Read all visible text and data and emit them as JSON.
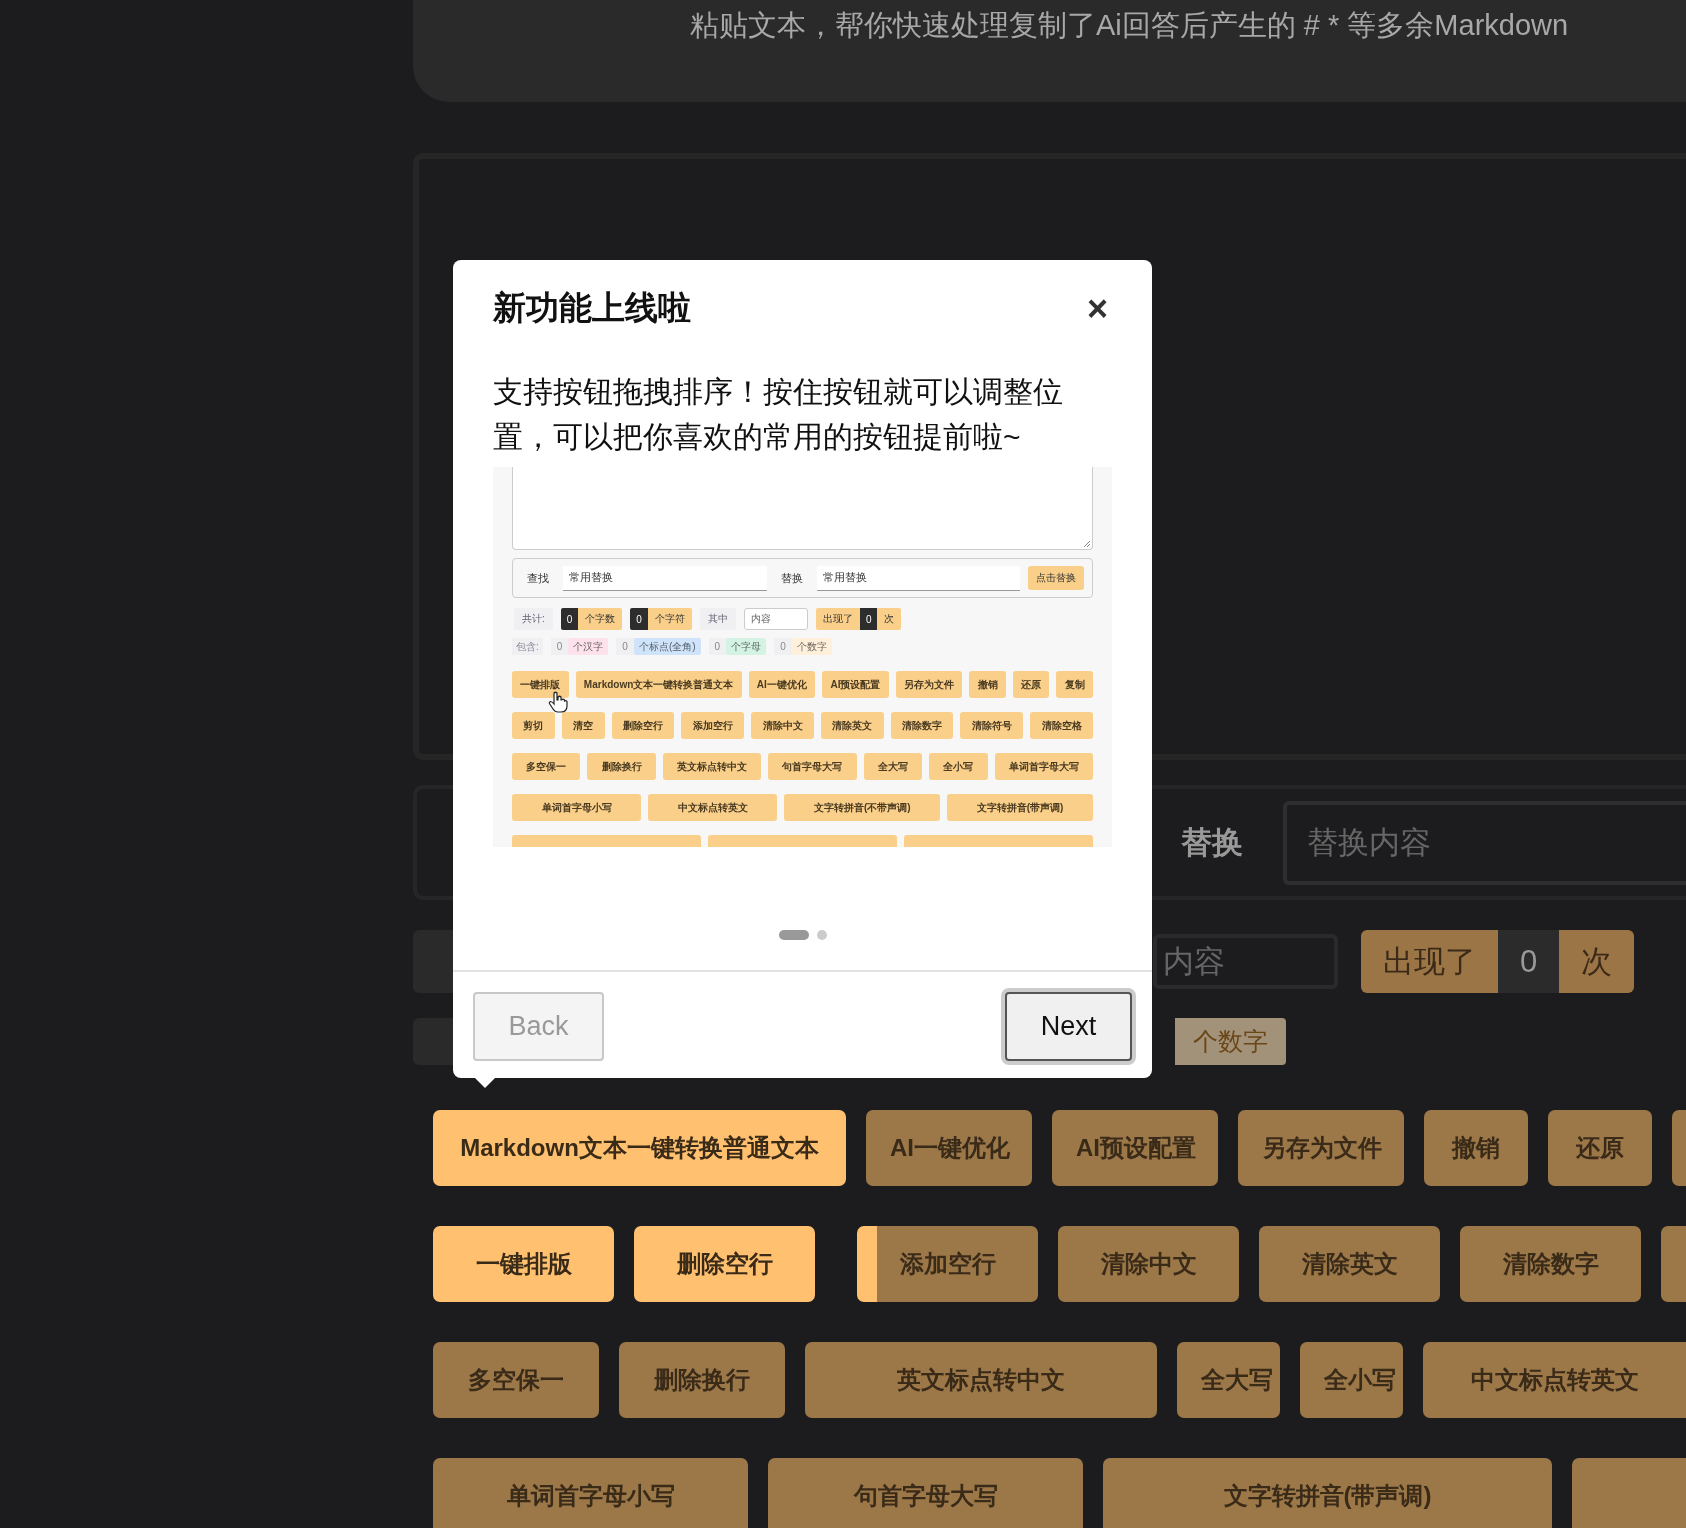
{
  "header": {
    "subtitle": "粘贴文本，帮你快速处理复制了Ai回答后产生的 # * 等多余Markdown"
  },
  "find_bar": {
    "replace_label": "替换",
    "replace_placeholder": "替换内容"
  },
  "count_row": {
    "search_placeholder": "内容",
    "appeared": "出现了",
    "count": "0",
    "times": "次"
  },
  "contains_row": {
    "tag": "个数字"
  },
  "button_rows": [
    [
      {
        "label": "Markdown文本一键转换普通文本",
        "highlighted": true
      },
      {
        "label": "AI一键优化",
        "highlighted": false
      },
      {
        "label": "AI预设配置",
        "highlighted": false
      },
      {
        "label": "另存为文件",
        "highlighted": false
      },
      {
        "label": "撤销",
        "highlighted": false
      },
      {
        "label": "还原",
        "highlighted": false
      },
      {
        "highlighted": false
      }
    ],
    [
      {
        "label": "一键排版",
        "highlighted": true
      },
      {
        "label": "删除空行",
        "highlighted": true
      },
      {
        "label": "添加空行",
        "highlighted": false
      },
      {
        "label": "清除中文",
        "highlighted": false
      },
      {
        "label": "清除英文",
        "highlighted": false
      },
      {
        "label": "清除数字",
        "highlighted": false
      },
      {
        "highlighted": false
      }
    ],
    [
      {
        "label": "多空保一",
        "highlighted": false
      },
      {
        "label": "删除换行",
        "highlighted": false
      },
      {
        "label": "英文标点转中文",
        "highlighted": false
      },
      {
        "label": "全大写",
        "highlighted": false
      },
      {
        "label": "全小写",
        "highlighted": false
      },
      {
        "label": "中文标点转英文",
        "highlighted": false
      }
    ],
    [
      {
        "label": "单词首字母小写",
        "highlighted": false
      },
      {
        "label": "句首字母大写",
        "highlighted": false
      },
      {
        "label": "文字转拼音(带声调)",
        "highlighted": false
      },
      {
        "highlighted": false
      }
    ]
  ],
  "modal": {
    "title": "新功能上线啦",
    "close": "×",
    "message": "支持按钮拖拽排序！按住按钮就可以调整位置，可以把你喜欢的常用的按钮提前啦~",
    "preview": {
      "find_label": "查找",
      "find_value": "常用替换",
      "replace_label": "替换",
      "replace_value": "常用替换",
      "replace_button": "点击替换",
      "total_label": "共计:",
      "counts": [
        {
          "value": "0",
          "unit": "个字数"
        },
        {
          "value": "0",
          "unit": "个字符"
        }
      ],
      "among_label": "其中",
      "among_placeholder": "内容",
      "appeared": "出现了",
      "appeared_count": "0",
      "times": "次",
      "contains_label": "包含:",
      "contains": [
        {
          "value": "0",
          "unit": "个汉字",
          "color": "#fde2ec"
        },
        {
          "value": "0",
          "unit": "个标点(全角)",
          "color": "#cfe4fa"
        },
        {
          "value": "0",
          "unit": "个字母",
          "color": "#d5f3e5"
        },
        {
          "value": "0",
          "unit": "个数字",
          "color": "#fff0dc"
        }
      ],
      "button_rows": [
        [
          "一键排版",
          "Markdown文本一键转换普通文本",
          "AI一键优化",
          "AI预设配置",
          "另存为文件",
          "撤销",
          "还原",
          "复制"
        ],
        [
          "剪切",
          "清空",
          "删除空行",
          "添加空行",
          "清除中文",
          "清除英文",
          "清除数字",
          "清除符号",
          "清除空格"
        ],
        [
          "多空保一",
          "删除换行",
          "英文标点转中文",
          "句首字母大写",
          "全大写",
          "全小写",
          "单词首字母大写"
        ],
        [
          "单词首字母小写",
          "中文标点转英文",
          "文字转拼音(不带声调)",
          "文字转拼音(带声调)"
        ]
      ]
    },
    "pager": [
      {
        "selected": true
      },
      {
        "selected": false
      }
    ],
    "back": {
      "label": "Back",
      "disabled": true
    },
    "next": {
      "label": "Next",
      "disabled": false
    }
  }
}
